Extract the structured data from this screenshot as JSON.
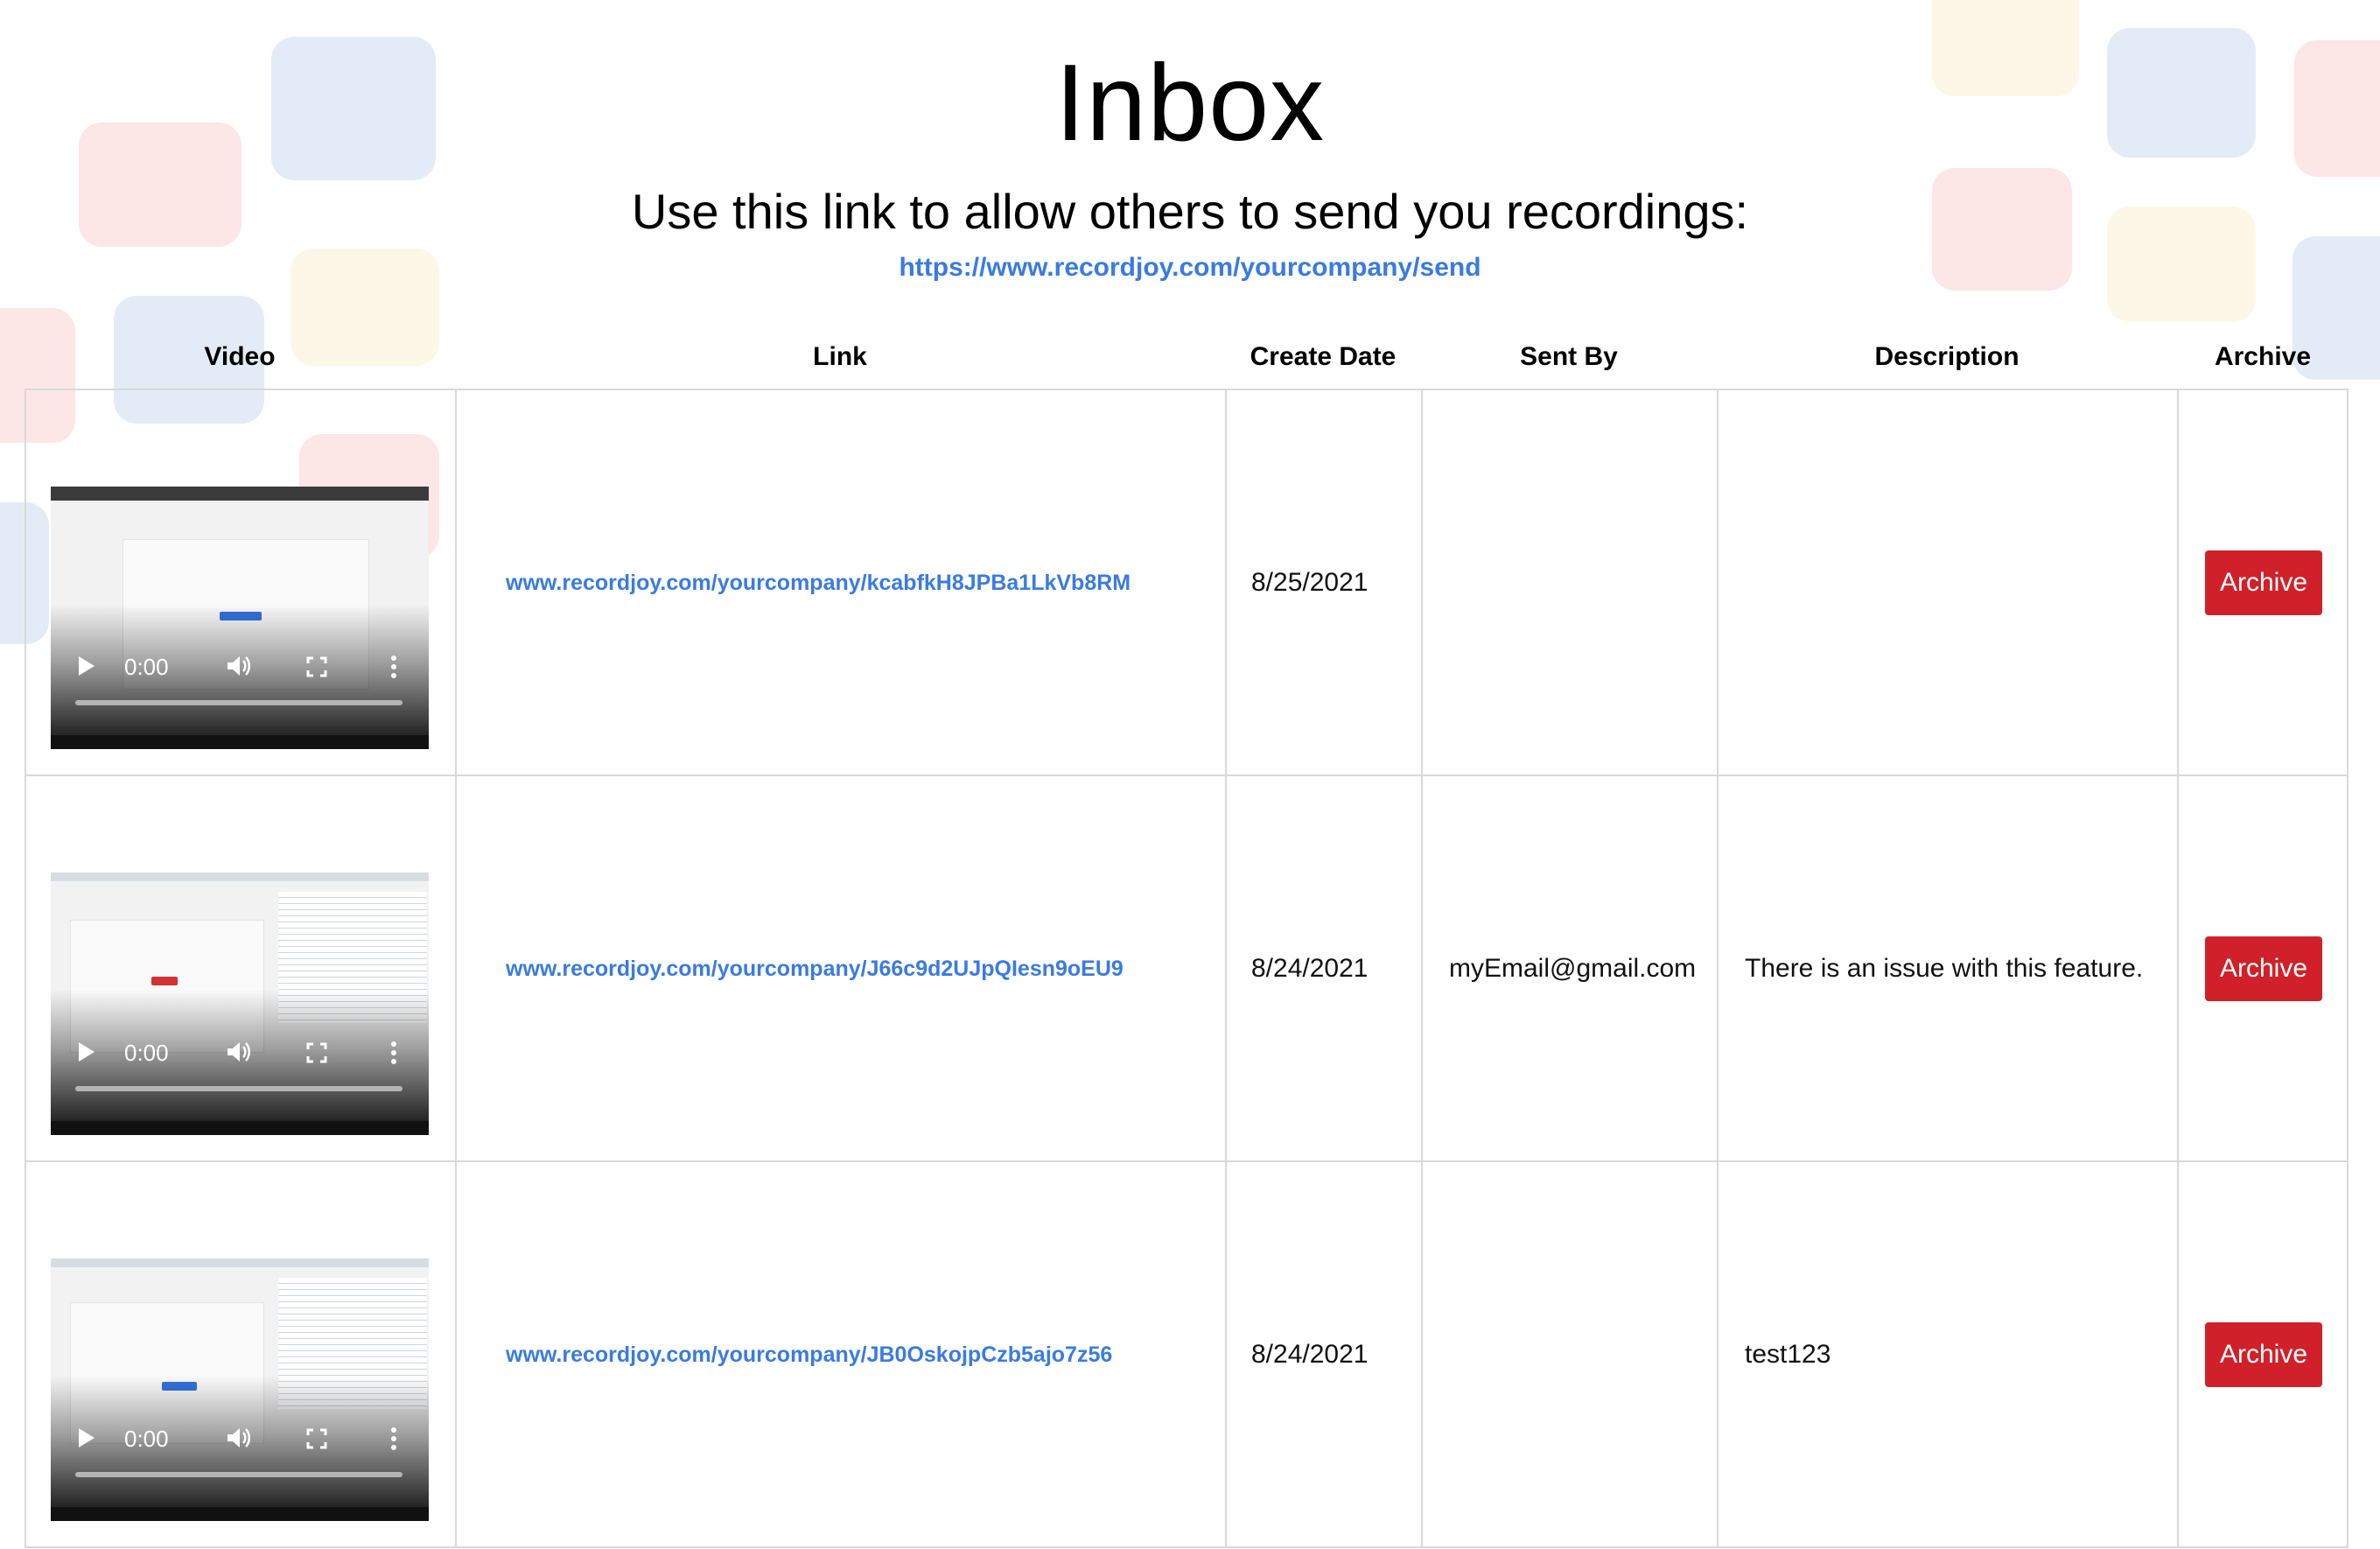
{
  "page": {
    "title": "Inbox",
    "subtitle": "Use this link to allow others to send you recordings:",
    "share_link": "https://www.recordjoy.com/yourcompany/send"
  },
  "colors": {
    "link": "#3a7be0",
    "archive_button": "#d0212a",
    "border": "#d9d9d9"
  },
  "table": {
    "headers": {
      "video": "Video",
      "link": "Link",
      "create_date": "Create Date",
      "sent_by": "Sent By",
      "description": "Description",
      "archive": "Archive"
    },
    "rows": [
      {
        "video_time": "0:00",
        "link": "www.recordjoy.com/yourcompany/kcabfkH8JPBa1LkVb8RM",
        "create_date": "8/25/2021",
        "sent_by": "",
        "description": "",
        "archive_label": "Archive"
      },
      {
        "video_time": "0:00",
        "link": "www.recordjoy.com/yourcompany/J66c9d2UJpQIesn9oEU9",
        "create_date": "8/24/2021",
        "sent_by": "myEmail@gmail.com",
        "description": "There is an issue with this feature.",
        "archive_label": "Archive"
      },
      {
        "video_time": "0:00",
        "link": "www.recordjoy.com/yourcompany/JB0OskojpCzb5ajo7z56",
        "create_date": "8/24/2021",
        "sent_by": "",
        "description": "test123",
        "archive_label": "Archive"
      }
    ]
  },
  "icons": {
    "play": "play-icon",
    "volume": "volume-icon",
    "fullscreen": "fullscreen-icon",
    "more": "more-vert-icon"
  }
}
